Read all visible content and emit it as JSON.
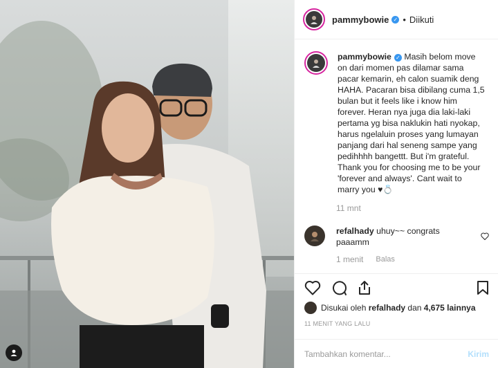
{
  "header": {
    "username": "pammybowie",
    "separator": "•",
    "follow_status": "Diikuti"
  },
  "caption": {
    "username": "pammybowie",
    "text": "Masih belom move on dari momen pas dilamar sama pacar kemarin, eh calon suamik deng HAHA. Pacaran bisa dibilang cuma 1,5 bulan but it feels like i know him forever. Heran nya juga dia laki-laki pertama yg bisa naklukin hati nyokap, harus ngelaluin proses yang lumayan panjang dari hal seneng sampe yang pedihhhh bangettt. But i'm grateful. Thank you for choosing me to be your 'forever and always'. Cant wait to marry you ♥💍",
    "time": "11 mnt"
  },
  "comment": {
    "username": "refalhady",
    "text": "uhuy~~ congrats paaamm",
    "time": "1 menit",
    "reply_label": "Balas"
  },
  "likes": {
    "prefix": "Disukai oleh",
    "user": "refalhady",
    "middle": "dan",
    "count": "4,675 lainnya"
  },
  "timestamp": "11 MENIT YANG LALU",
  "comment_input": {
    "placeholder": "Tambahkan komentar...",
    "post_label": "Kirim"
  },
  "icons": {
    "verified": "verified-badge-icon",
    "like": "heart-icon",
    "comment": "comment-bubble-icon",
    "share": "share-icon",
    "save": "bookmark-icon",
    "comment_like": "small-heart-icon"
  }
}
